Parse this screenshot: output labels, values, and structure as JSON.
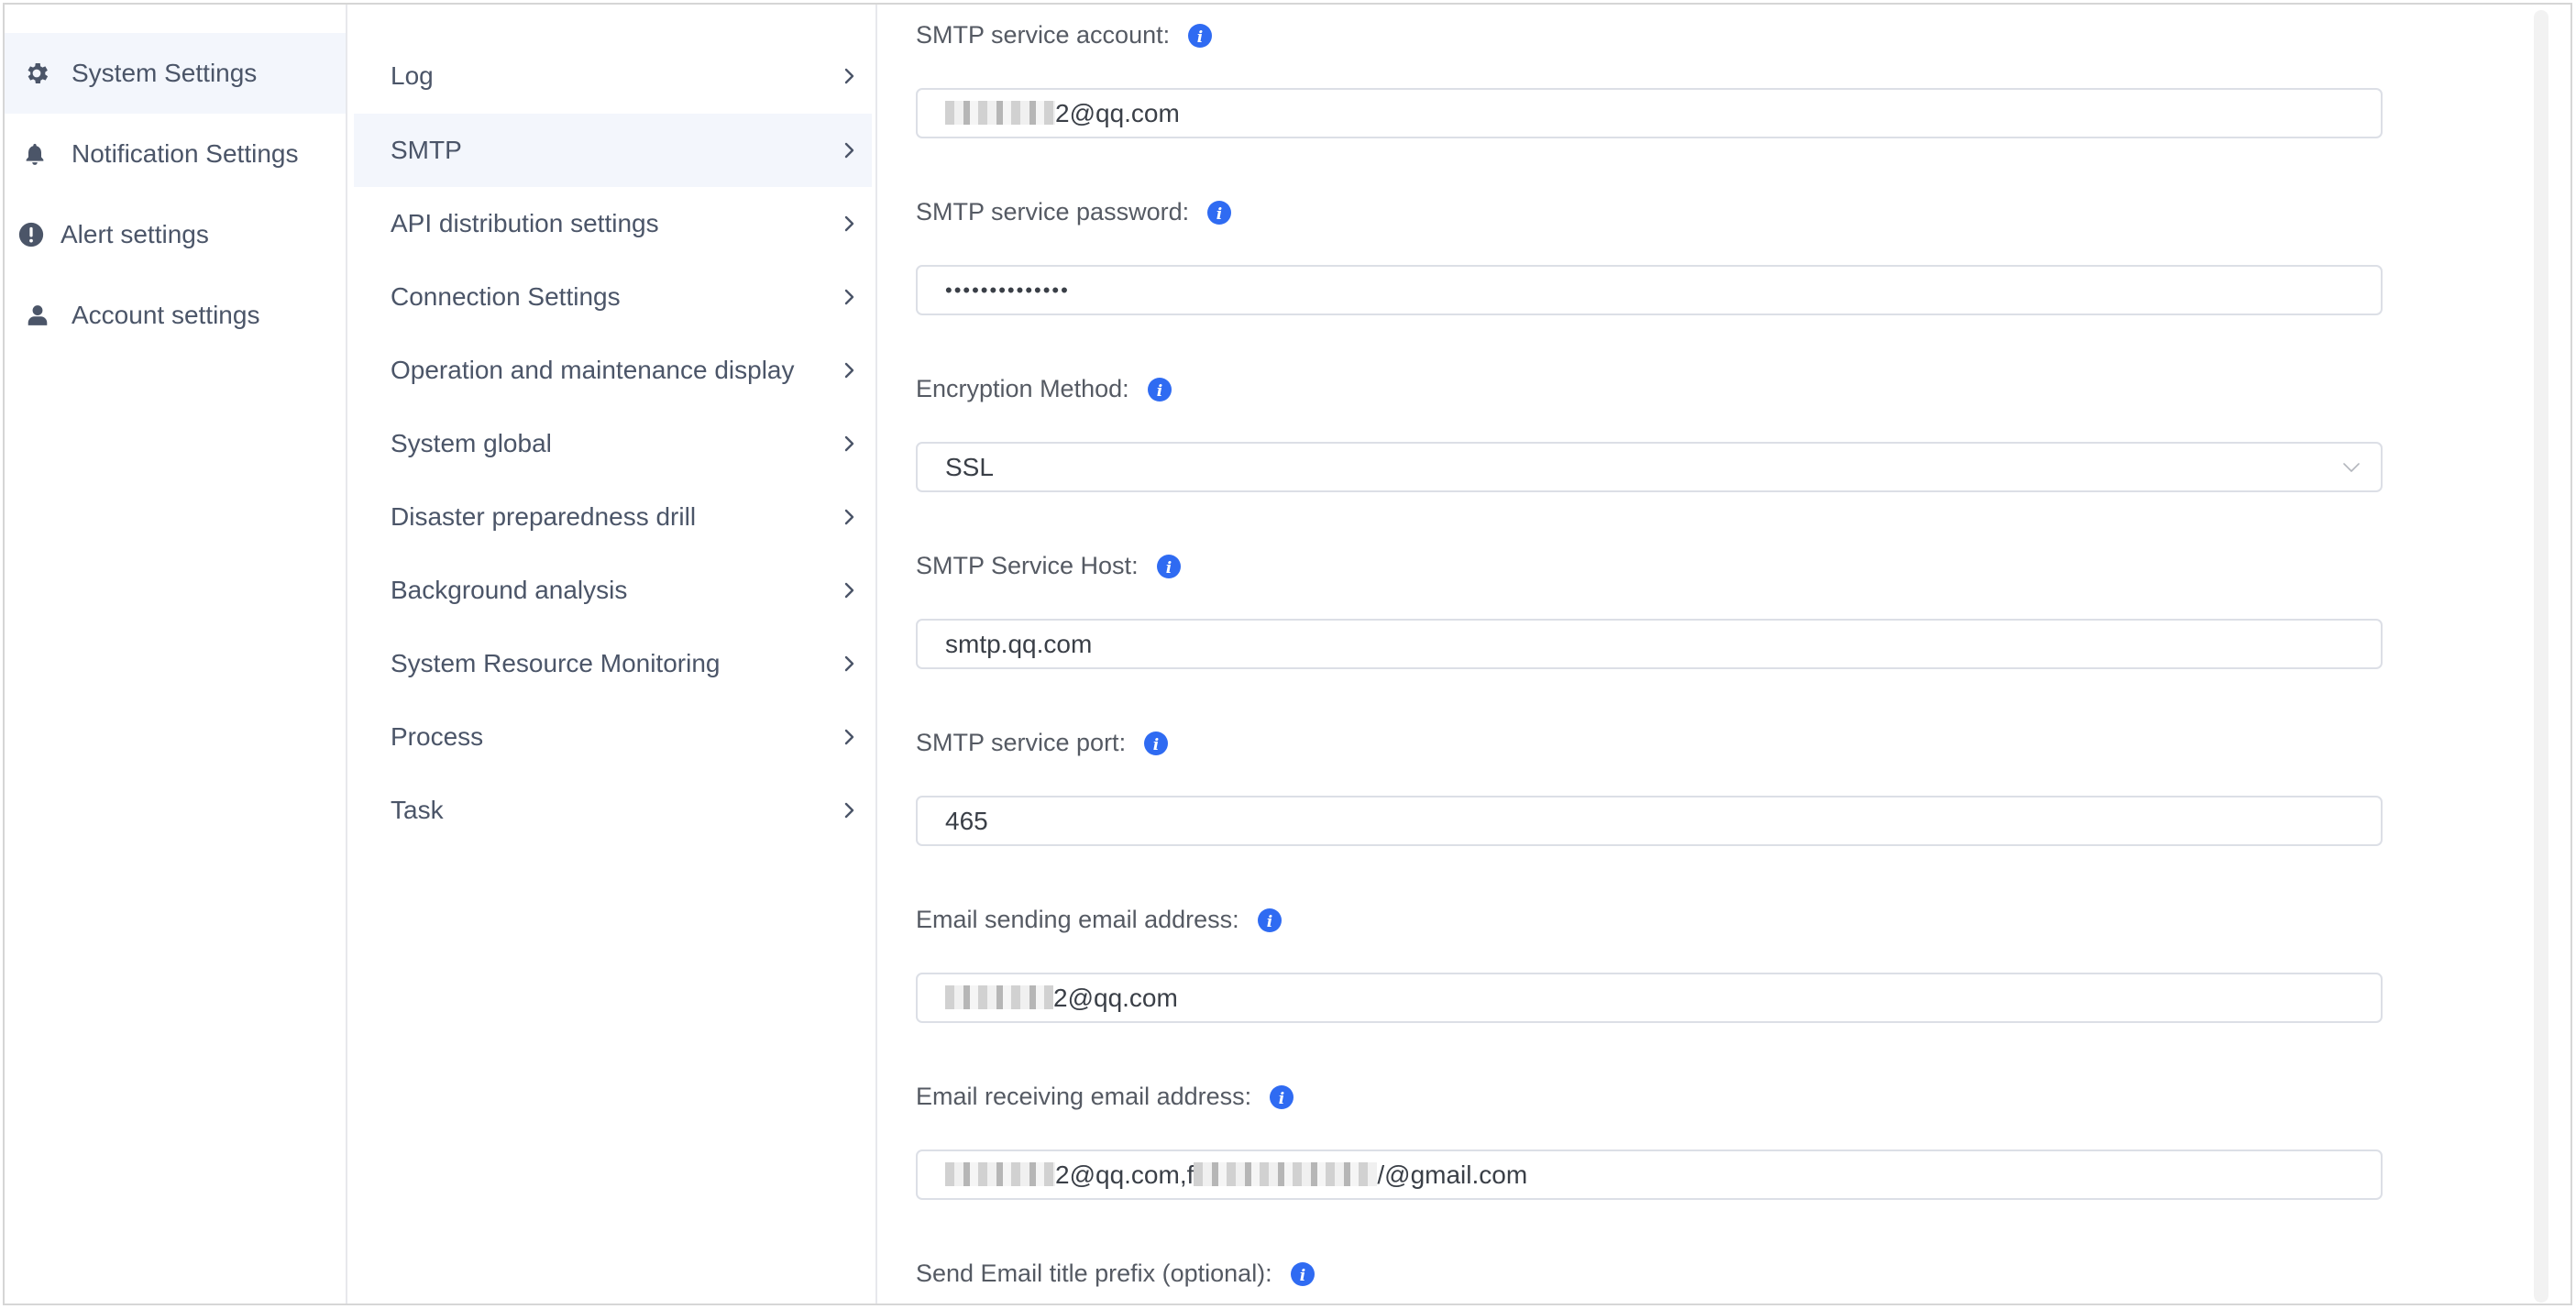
{
  "sidebar_primary": {
    "items": [
      {
        "label": "System Settings",
        "icon": "gear-icon",
        "active": true
      },
      {
        "label": "Notification Settings",
        "icon": "bell-icon",
        "active": false
      },
      {
        "label": "Alert settings",
        "icon": "alert-circle-icon",
        "active": false
      },
      {
        "label": "Account settings",
        "icon": "user-icon",
        "active": false
      }
    ]
  },
  "sidebar_secondary": {
    "items": [
      {
        "label": "Log",
        "active": false
      },
      {
        "label": "SMTP",
        "active": true
      },
      {
        "label": "API distribution settings",
        "active": false
      },
      {
        "label": "Connection Settings",
        "active": false
      },
      {
        "label": "Operation and maintenance display",
        "active": false
      },
      {
        "label": "System global",
        "active": false
      },
      {
        "label": "Disaster preparedness drill",
        "active": false
      },
      {
        "label": "Background analysis",
        "active": false
      },
      {
        "label": "System Resource Monitoring",
        "active": false
      },
      {
        "label": "Process",
        "active": false
      },
      {
        "label": "Task",
        "active": false
      }
    ]
  },
  "form": {
    "fields": [
      {
        "label": "SMTP service account:",
        "type": "text",
        "value_visible": "2@qq.com",
        "value_redacted_prefix": true
      },
      {
        "label": "SMTP service password:",
        "type": "password",
        "value": "••••••••••••••"
      },
      {
        "label": "Encryption Method:",
        "type": "select",
        "value": "SSL"
      },
      {
        "label": "SMTP Service Host:",
        "type": "text",
        "value": "smtp.qq.com"
      },
      {
        "label": "SMTP service port:",
        "type": "text",
        "value": "465"
      },
      {
        "label": "Email sending email address:",
        "type": "text",
        "value_visible": "2@qq.com",
        "value_redacted_prefix": true
      },
      {
        "label": "Email receiving email address:",
        "type": "text",
        "value_part1": "2@qq.com,f",
        "value_part2": "/@gmail.com",
        "value_redacted": true
      },
      {
        "label": "Send Email title prefix (optional):",
        "type": "text"
      }
    ]
  },
  "colors": {
    "active_bg": "#f3f6fc",
    "info_icon": "#2f6bf2",
    "text": "#4b5568",
    "border": "#dcdfe6"
  }
}
